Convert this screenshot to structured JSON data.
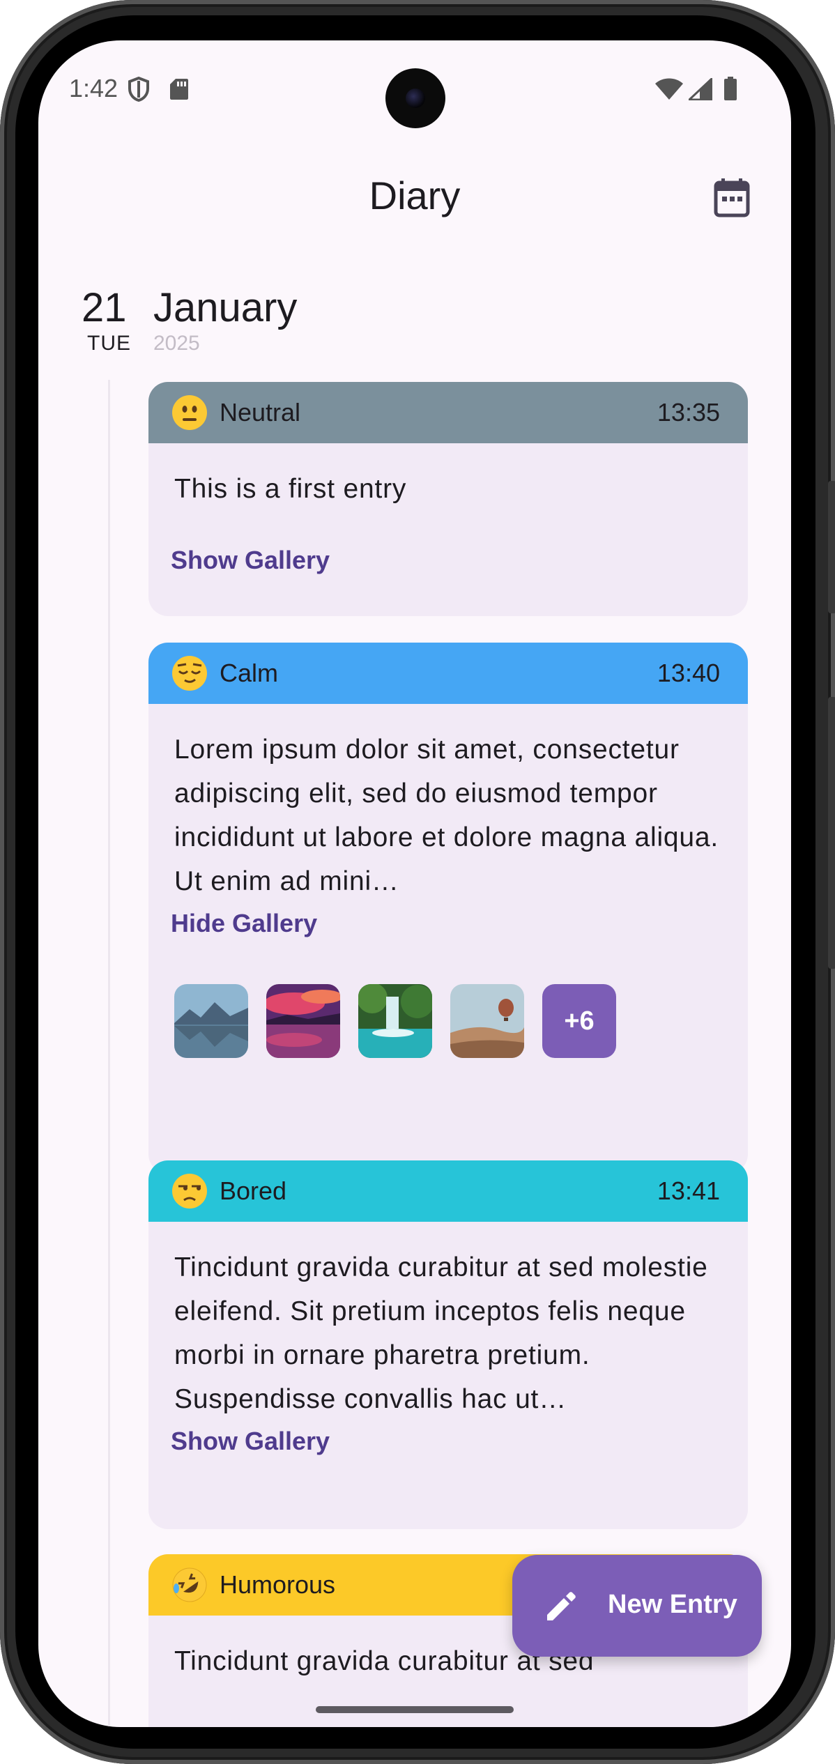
{
  "status_bar": {
    "time": "1:42",
    "icons": [
      "shield-icon",
      "sd-card-icon",
      "wifi-icon",
      "signal-icon",
      "battery-icon"
    ]
  },
  "app_bar": {
    "title": "Diary",
    "calendar_icon": "calendar-icon"
  },
  "date_header": {
    "day": "21",
    "weekday": "TUE",
    "month": "January",
    "year": "2025"
  },
  "entries": [
    {
      "mood": "Neutral",
      "mood_icon": "neutral-face-icon",
      "mood_color": "#7b909c",
      "time": "13:35",
      "text": "This is a first entry",
      "gallery_toggle": "Show Gallery"
    },
    {
      "mood": "Calm",
      "mood_icon": "relieved-face-icon",
      "mood_color": "#45a6f4",
      "time": "13:40",
      "text": "Lorem ipsum dolor sit amet, consectetur adipiscing elit, sed do eiusmod tempor incididunt ut labore et dolore magna aliqua. Ut enim ad mini…",
      "gallery_toggle": "Hide Gallery",
      "gallery_more": "+6"
    },
    {
      "mood": "Bored",
      "mood_icon": "unamused-face-icon",
      "mood_color": "#27c4d8",
      "time": "13:41",
      "text": "Tincidunt gravida curabitur at sed molestie eleifend. Sit pretium inceptos felis neque morbi in ornare pharetra pretium. Suspendisse convallis hac ut…",
      "gallery_toggle": "Show Gallery"
    },
    {
      "mood": "Humorous",
      "mood_icon": "rolling-laughing-face-icon",
      "mood_color": "#fcc928",
      "text": "Tincidunt gravida curabitur at sed"
    }
  ],
  "fab": {
    "label": "New Entry",
    "icon": "pencil-icon",
    "color": "#7c5eb7"
  }
}
